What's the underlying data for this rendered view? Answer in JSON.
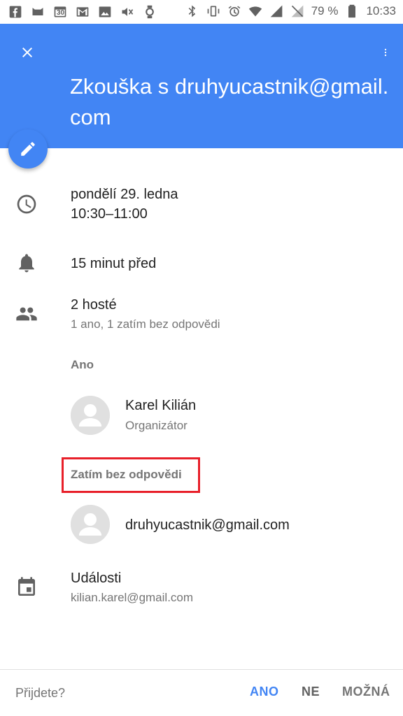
{
  "statusbar": {
    "calendar_day": "30",
    "battery": "79 %",
    "time": "10:33"
  },
  "event": {
    "title": "Zkouška s druhyucastnik@gmail.com",
    "date": "pondělí 29. ledna",
    "time_range": "10:30–11:00",
    "reminder": "15 minut před",
    "guests_count": "2 hosté",
    "guests_summary": "1 ano, 1 zatím bez odpovědi",
    "calendar_name": "Události",
    "calendar_owner": "kilian.karel@gmail.com"
  },
  "guests": {
    "yes_label": "Ano",
    "yes": [
      {
        "name": "Karel Kilián",
        "role": "Organizátor"
      }
    ],
    "pending_label": "Zatím bez odpovědi",
    "pending": [
      {
        "name": "druhyucastnik@gmail.com"
      }
    ]
  },
  "rsvp": {
    "question": "Přijdete?",
    "yes": "ANO",
    "no": "NE",
    "maybe": "MOŽNÁ"
  },
  "colors": {
    "header": "#4285f4",
    "accent": "#4285f4",
    "highlight": "#e8202a"
  }
}
